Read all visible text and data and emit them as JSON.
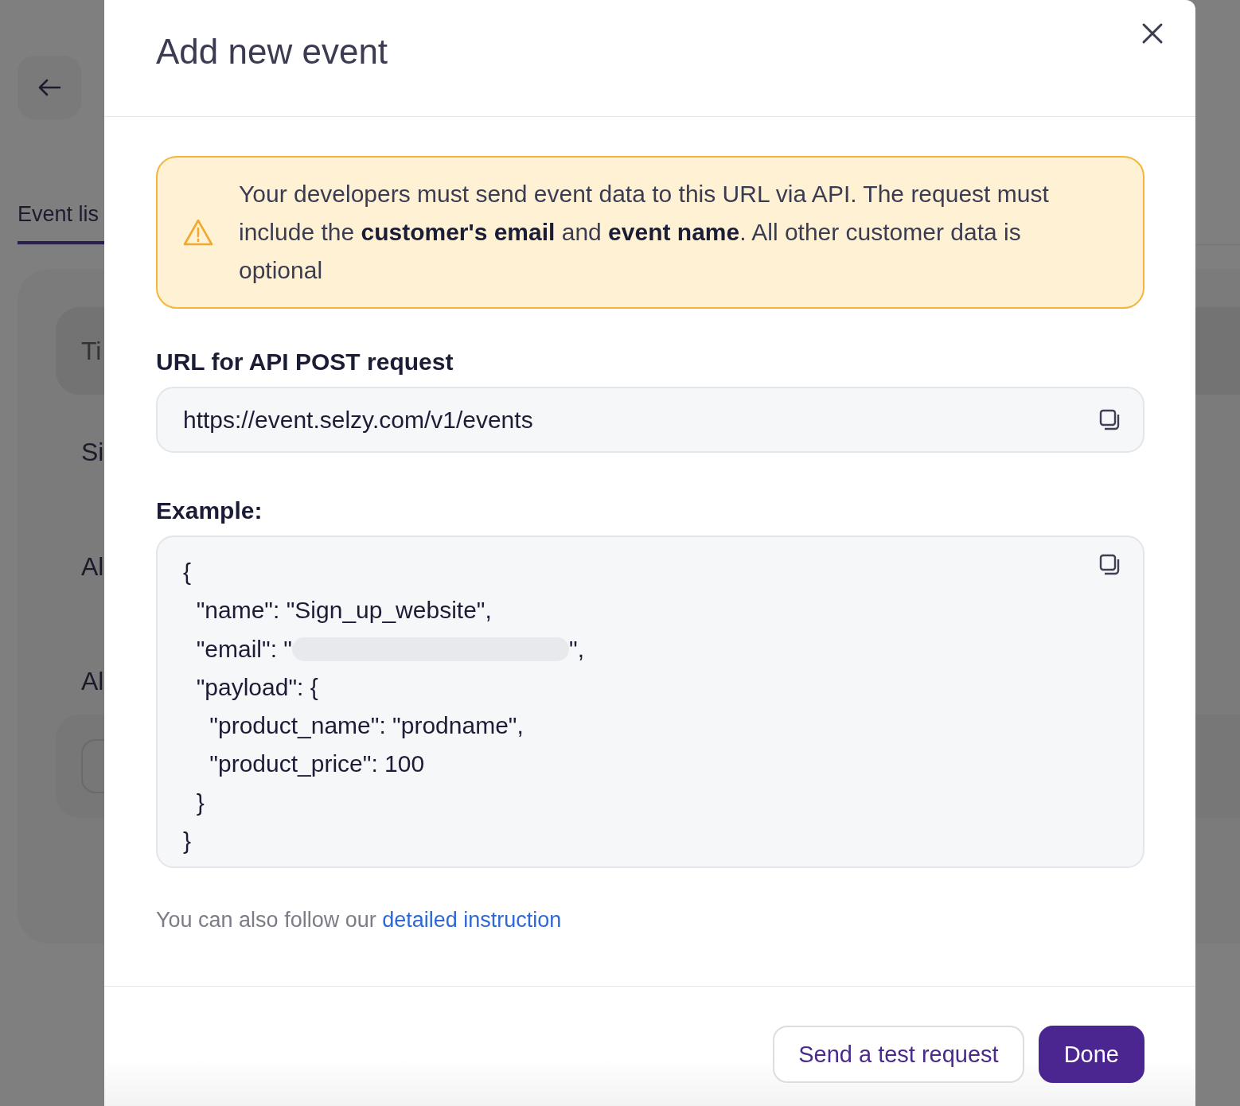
{
  "background": {
    "tab": {
      "label": "Event lis",
      "selected": true
    },
    "table": {
      "header": "Ti",
      "rows": [
        "Si",
        "Al",
        "Al"
      ]
    }
  },
  "modal": {
    "title": "Add new event",
    "alert": "Your developers must send event data to this URL via API. The request must include the **customer's email** and **event name**. All other customer data is optional",
    "url_field": {
      "label": "URL for API POST request",
      "value": "https://event.selzy.com/v1/events"
    },
    "example": {
      "label": "Example:",
      "lines": [
        {
          "kind": "text",
          "text": "{"
        },
        {
          "kind": "text",
          "text": "  \"name\": \"Sign_up_website\","
        },
        {
          "kind": "redacted",
          "before": "  \"email\": \"",
          "after": "\","
        },
        {
          "kind": "text",
          "text": "  \"payload\": {"
        },
        {
          "kind": "text",
          "text": "    \"product_name\": \"prodname\","
        },
        {
          "kind": "text",
          "text": "    \"product_price\": 100"
        },
        {
          "kind": "text",
          "text": "  }"
        },
        {
          "kind": "text",
          "text": "}"
        }
      ]
    },
    "footer_note": {
      "text": "You can also follow our",
      "link": "detailed instruction"
    },
    "buttons": [
      {
        "label": "Send a test request",
        "kind": "secondary"
      },
      {
        "label": "Done",
        "kind": "primary"
      }
    ]
  }
}
